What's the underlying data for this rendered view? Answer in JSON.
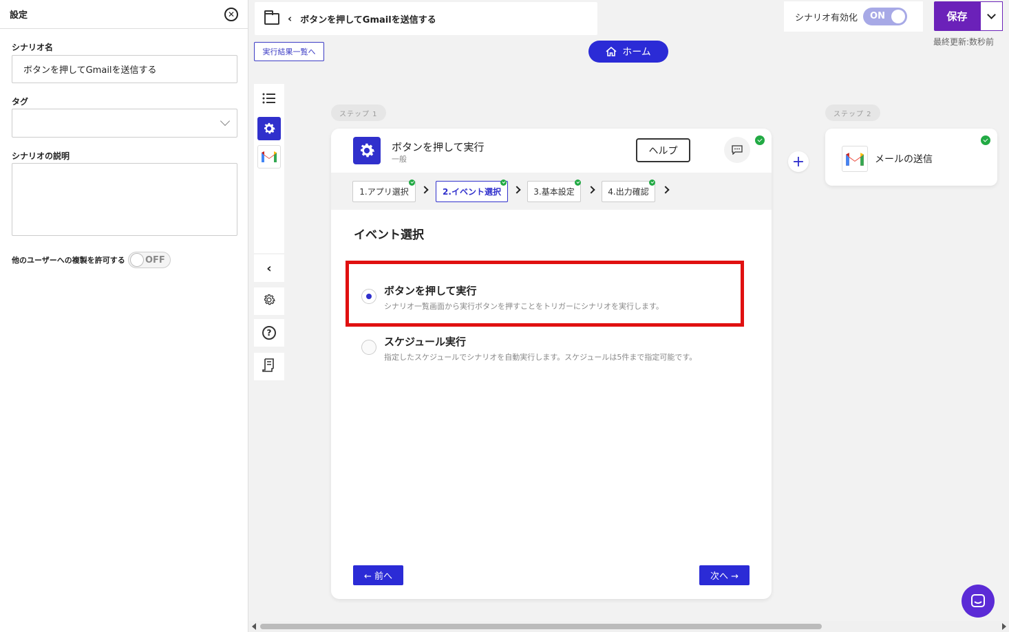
{
  "settings": {
    "title": "設定",
    "name_label": "シナリオ名",
    "name_value": "ボタンを押してGmailを送信する",
    "tag_label": "タグ",
    "desc_label": "シナリオの説明",
    "copy_label": "他のユーザーへの複製を許可する",
    "copy_toggle": "OFF"
  },
  "header": {
    "breadcrumb_title": "ボタンを押してGmailを送信する",
    "results_link": "実行結果一覧へ",
    "home_label": "ホーム",
    "enable_label": "シナリオ有効化",
    "enable_toggle": "ON",
    "save_label": "保存",
    "last_updated": "最終更新:数秒前"
  },
  "steps": {
    "step1_tag": "ステップ 1",
    "step2_tag": "ステップ 2",
    "step2_title": "メールの送信"
  },
  "card": {
    "title": "ボタンを押して実行",
    "subtitle": "一般",
    "help_label": "ヘルプ",
    "tabs": [
      {
        "label": "1.アプリ選択"
      },
      {
        "label": "2.イベント選択"
      },
      {
        "label": "3.基本設定"
      },
      {
        "label": "4.出力確認"
      }
    ],
    "section_title": "イベント選択",
    "options": [
      {
        "title": "ボタンを押して実行",
        "desc": "シナリオ一覧画面から実行ボタンを押すことをトリガーにシナリオを実行します。",
        "selected": true
      },
      {
        "title": "スケジュール実行",
        "desc": "指定したスケジュールでシナリオを自動実行します。スケジュールは5件まで指定可能です。",
        "selected": false
      }
    ],
    "prev_label": "← 前へ",
    "next_label": "次へ →"
  },
  "colors": {
    "accent": "#2b2bd6",
    "save": "#6b21b9",
    "highlight": "#e01010",
    "check": "#22aa44"
  }
}
